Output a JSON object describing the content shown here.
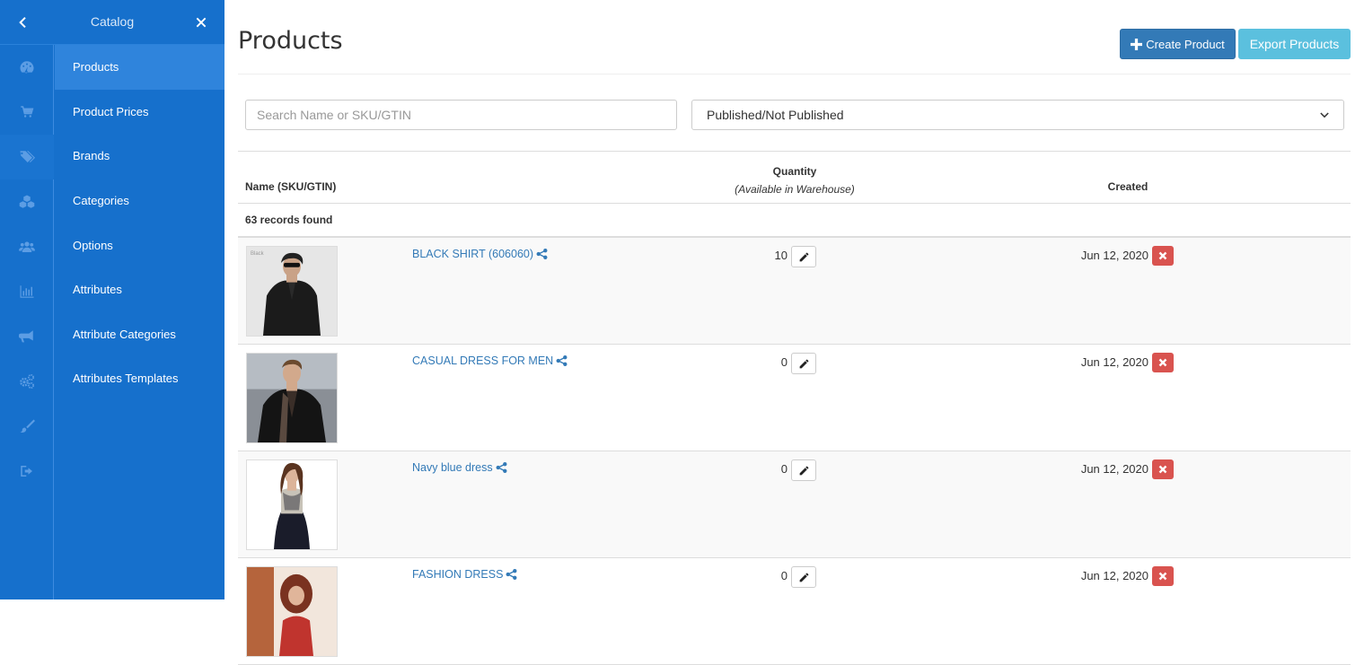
{
  "sidebar": {
    "title": "Catalog",
    "back_icon": "chevron-left-icon",
    "close_icon": "close-icon",
    "rail_icons": [
      "dashboard-icon",
      "cart-icon",
      "tags-icon",
      "cubes-icon",
      "users-icon",
      "bar-chart-icon",
      "bullhorn-icon",
      "cogs-icon",
      "paint-brush-icon",
      "sign-out-icon"
    ],
    "items": [
      {
        "label": "Products",
        "active": true
      },
      {
        "label": "Product Prices",
        "active": false
      },
      {
        "label": "Brands",
        "active": false
      },
      {
        "label": "Categories",
        "active": false
      },
      {
        "label": "Options",
        "active": false
      },
      {
        "label": "Attributes",
        "active": false
      },
      {
        "label": "Attribute Categories",
        "active": false
      },
      {
        "label": "Attributes Templates",
        "active": false
      }
    ]
  },
  "header": {
    "title": "Products",
    "create_label": "Create Product",
    "export_label": "Export Products"
  },
  "filters": {
    "search_placeholder": "Search Name or SKU/GTIN",
    "search_value": "",
    "publish_select": "Published/Not Published"
  },
  "table": {
    "col_name": "Name (SKU/GTIN)",
    "col_qty": "Quantity",
    "col_qty_sub": "(Available in Warehouse)",
    "col_created": "Created",
    "records": "63 records found",
    "rows": [
      {
        "name": "BLACK SHIRT (606060)",
        "qty": "10",
        "created": "Jun 12, 2020",
        "thumb_label": "Black"
      },
      {
        "name": "CASUAL DRESS FOR MEN",
        "qty": "0",
        "created": "Jun 12, 2020",
        "thumb_label": ""
      },
      {
        "name": "Navy blue dress",
        "qty": "0",
        "created": "Jun 12, 2020",
        "thumb_label": ""
      },
      {
        "name": "FASHION DRESS",
        "qty": "0",
        "created": "Jun 12, 2020",
        "thumb_label": ""
      }
    ]
  },
  "colors": {
    "sidebar_bg": "#1670cc",
    "active_item": "#2f84dc",
    "primary": "#337ab7",
    "info": "#5bc0de",
    "danger": "#d9534f"
  }
}
